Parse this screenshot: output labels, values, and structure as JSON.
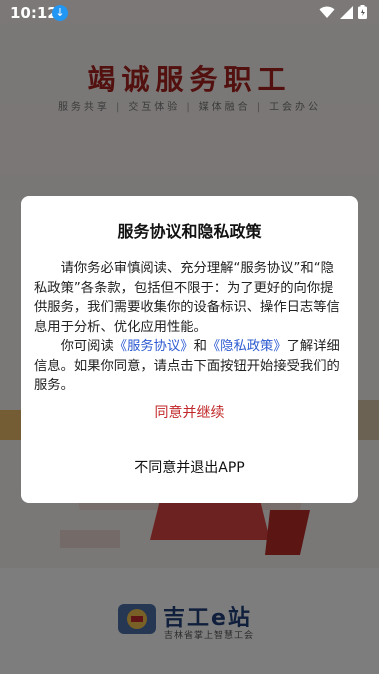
{
  "status_bar": {
    "time": "10:12"
  },
  "splash": {
    "title": "竭诚服务职工",
    "tags": [
      "服务共享",
      "交互体验",
      "媒体融合",
      "工会办公"
    ],
    "brand_name": "吉工e站",
    "brand_subtitle": "吉林省掌上智慧工会"
  },
  "dialog": {
    "title": "服务协议和隐私政策",
    "paragraph1": "请你务必审慎阅读、充分理解“服务协议”和“隐私政策”各条款，包括但不限于：为了更好的向你提供服务，我们需要收集你的设备标识、操作日志等信息用于分析、优化应用性能。",
    "paragraph2_prefix": "你可阅读",
    "link_service": "《服务协议》",
    "paragraph2_and": "和",
    "link_privacy": "《隐私政策》",
    "paragraph2_suffix": "了解详细信息。如果你同意，请点击下面按钮开始接受我们的服务。",
    "agree_label": "同意并继续",
    "exit_label": "不同意并退出APP"
  },
  "colors": {
    "accent_red": "#c0282a",
    "link_blue": "#2d5bd1",
    "status_download": "#2196f3"
  }
}
